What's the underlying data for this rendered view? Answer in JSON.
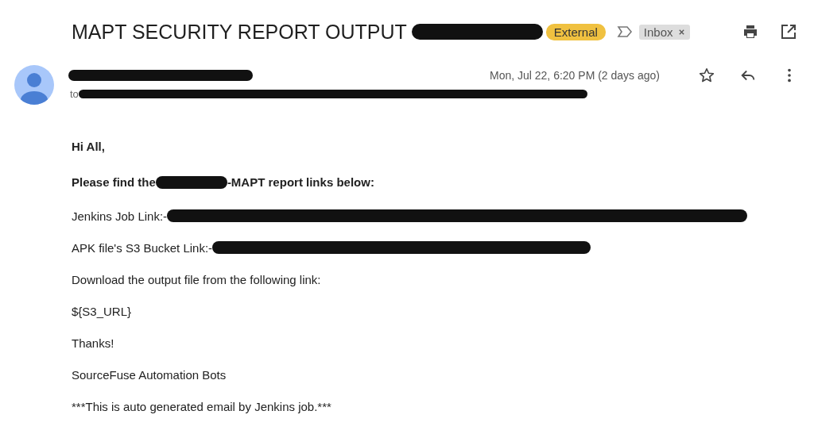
{
  "subject": {
    "text": "MAPT SECURITY REPORT OUTPUT",
    "redacted": true,
    "labels": [
      {
        "text": "External",
        "kind": "external"
      },
      {
        "text": "Inbox",
        "kind": "inbox",
        "removable": true
      }
    ]
  },
  "message": {
    "sender_redacted": true,
    "date": "Mon, Jul 22, 6:20 PM (2 days ago)",
    "starred": false,
    "to_label": "to",
    "recipients_redacted": true
  },
  "body": [
    {
      "text": "Hi All,",
      "bold": true
    },
    {
      "text": "Please find the",
      "bold": true,
      "redacted": true,
      "after": "-MAPT report links below:"
    },
    {
      "text": "Jenkins Job Link:-",
      "bold": false,
      "redacted": true
    },
    {
      "text": "APK file's S3 Bucket Link:-",
      "bold": false,
      "redacted": true
    },
    {
      "text": "Download the output file from the following link:",
      "bold": false
    },
    {
      "text": "${S3_URL}",
      "bold": false
    },
    {
      "text": "Thanks!",
      "bold": false
    },
    {
      "text": "SourceFuse Automation Bots",
      "bold": false
    },
    {
      "text": "***This is auto generated email by Jenkins job.***",
      "bold": false
    }
  ]
}
